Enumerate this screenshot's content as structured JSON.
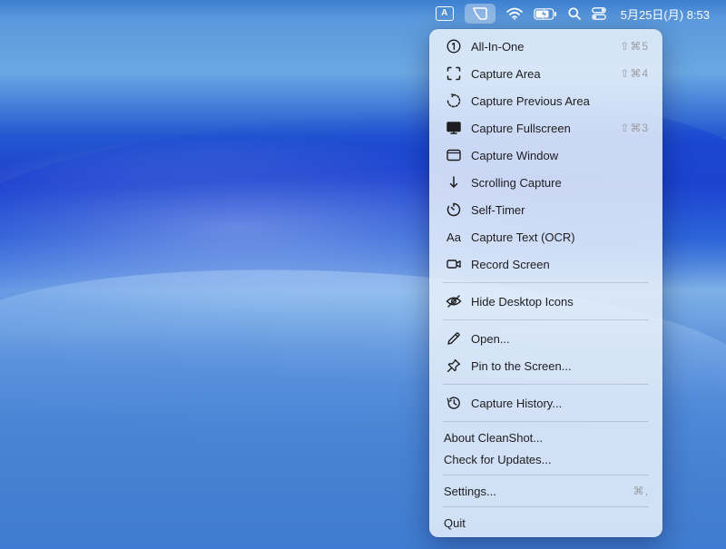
{
  "menubar": {
    "input_label": "A",
    "clock": "5月25日(月) 8:53"
  },
  "menu": {
    "items": [
      {
        "label": "All-In-One",
        "icon": "number-one-circle-icon",
        "shortcut": "⇧⌘5"
      },
      {
        "label": "Capture Area",
        "icon": "dashed-square-icon",
        "shortcut": "⇧⌘4"
      },
      {
        "label": "Capture Previous Area",
        "icon": "dashed-circle-arrow-icon",
        "shortcut": ""
      },
      {
        "label": "Capture Fullscreen",
        "icon": "monitor-icon",
        "shortcut": "⇧⌘3"
      },
      {
        "label": "Capture Window",
        "icon": "window-icon",
        "shortcut": ""
      },
      {
        "label": "Scrolling Capture",
        "icon": "arrow-down-icon",
        "shortcut": ""
      },
      {
        "label": "Self-Timer",
        "icon": "timer-icon",
        "shortcut": ""
      },
      {
        "label": "Capture Text (OCR)",
        "icon": "text-aa-icon",
        "icon_text": "Aa",
        "shortcut": ""
      },
      {
        "label": "Record Screen",
        "icon": "video-camera-icon",
        "shortcut": ""
      },
      {
        "label": "Hide Desktop Icons",
        "icon": "eye-slash-icon",
        "shortcut": ""
      },
      {
        "label": "Open...",
        "icon": "pencil-icon",
        "shortcut": ""
      },
      {
        "label": "Pin to the Screen...",
        "icon": "pin-icon",
        "shortcut": ""
      },
      {
        "label": "Capture History...",
        "icon": "history-icon",
        "shortcut": ""
      },
      {
        "label": "About CleanShot...",
        "shortcut": ""
      },
      {
        "label": "Check for Updates...",
        "shortcut": ""
      },
      {
        "label": "Settings...",
        "shortcut": "⌘,"
      },
      {
        "label": "Quit",
        "shortcut": ""
      }
    ]
  }
}
